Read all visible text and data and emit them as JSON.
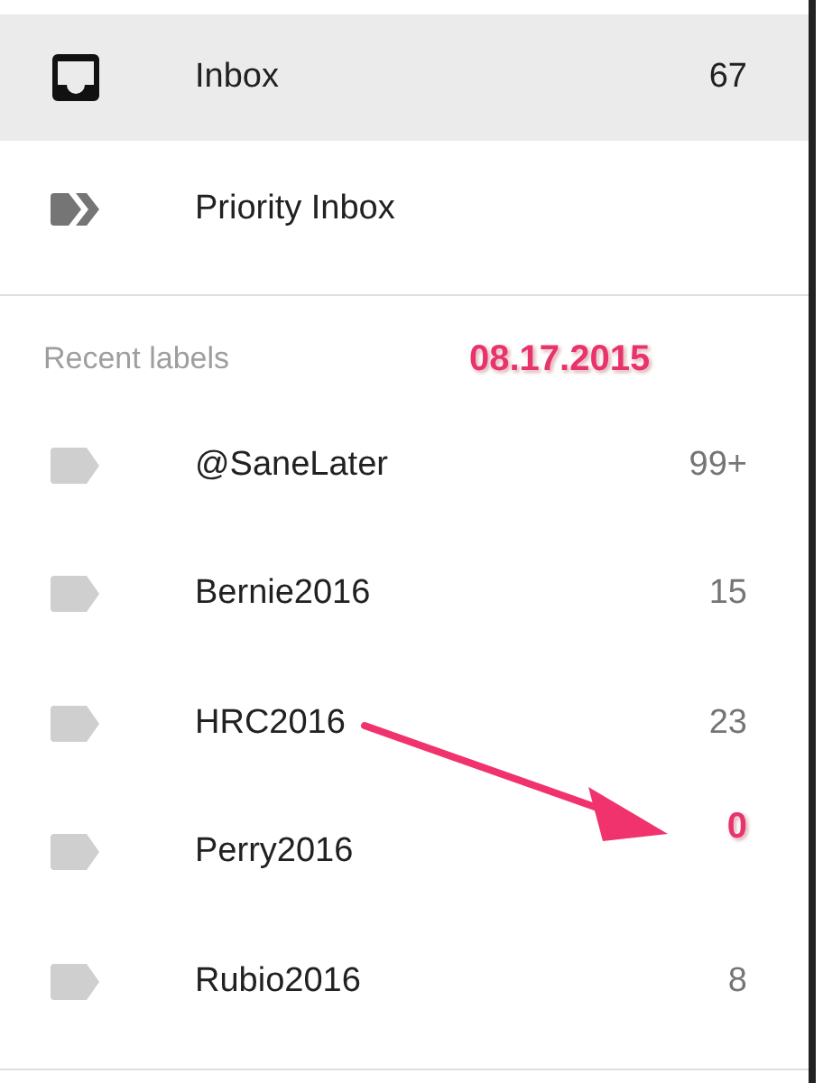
{
  "nav": [
    {
      "kind": "inbox",
      "label": "Inbox",
      "count": "67",
      "selected": true
    },
    {
      "kind": "priority",
      "label": "Priority Inbox",
      "selected": false
    }
  ],
  "recent_labels": {
    "heading": "Recent labels",
    "annotation_date": "08.17.2015",
    "items": [
      {
        "label": "@SaneLater",
        "count": "99+",
        "annotated": false
      },
      {
        "label": "Bernie2016",
        "count": "15",
        "annotated": false
      },
      {
        "label": "HRC2016",
        "count": "23",
        "annotated": false
      },
      {
        "label": "Perry2016",
        "count": "0",
        "annotated": true
      },
      {
        "label": "Rubio2016",
        "count": "8",
        "annotated": false
      }
    ]
  }
}
